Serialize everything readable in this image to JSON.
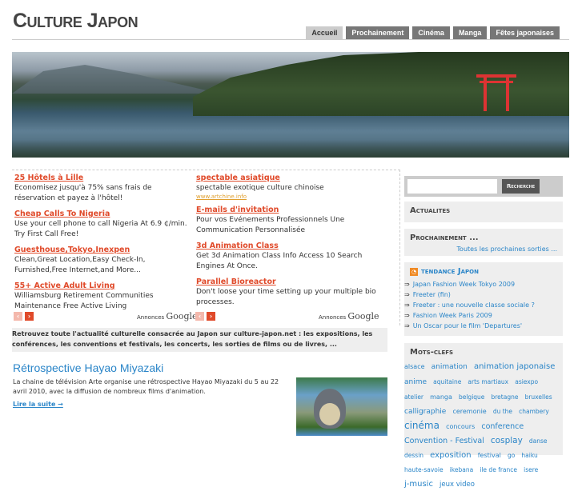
{
  "site": {
    "title": "Culture Japon"
  },
  "nav": {
    "tabs": [
      {
        "label": "Accueil",
        "active": true
      },
      {
        "label": "Prochainement"
      },
      {
        "label": "Cinéma"
      },
      {
        "label": "Manga"
      },
      {
        "label": "Fêtes japonaises"
      }
    ]
  },
  "ads": {
    "left": [
      {
        "title": "25 Hôtels à Lille",
        "text": "Economisez jusqu'à 75% sans frais de réservation et payez à l'hôtel!"
      },
      {
        "title": "Cheap Calls To Nigeria",
        "text": "Use your cell phone to call Nigeria At 6.9 ¢/min. Try First Call Free!"
      },
      {
        "title": "Guesthouse,Tokyo,Inexpen",
        "text": "Clean,Great Location,Easy Check-In, Furnished,Free Internet,and More..."
      },
      {
        "title": "55+ Active Adult Living",
        "text": "Williamsburg Retirement Communities Maintenance Free Active Living"
      }
    ],
    "right": [
      {
        "title": "spectable asiatique",
        "text": "spectable exotique culture chinoise",
        "url": "www.artchine.info"
      },
      {
        "title": "E-mails d'invitation",
        "text": "Pour vos Evénements Professionnels Une Communication Personnalisée"
      },
      {
        "title": "3d Animation Class",
        "text": "Get 3d Animation Class Info Access 10 Search Engines At Once."
      },
      {
        "title": "Parallel Bioreactor",
        "text": "Don't loose your time setting up your multiple bio processes."
      }
    ],
    "annonces": "Annonces",
    "google": "Google"
  },
  "intro": "Retrouvez toute l'actualité culturelle consacrée au Japon sur culture-japon.net : les expositions, les conférences, les conventions et festivals, les concerts, les sorties de films ou de livres, ...",
  "post": {
    "title": "Rétrospective Hayao Miyazaki",
    "text": "La chaine de télévision Arte organise une rétrospective Hayao Miyazaki du 5 au 22 avril 2010, avec la diffusion de nombreux films d'animation.",
    "read_more": "Lire la suite →"
  },
  "sidebar": {
    "search_button": "Recherche",
    "actualites": "Actualites",
    "prochainement": "Prochainement ...",
    "prochainement_link": "Toutes les prochaines sorties ...",
    "tendance": "tendance Japon",
    "tendance_items": [
      "Japan Fashion Week Tokyo 2009",
      "Freeter (fin)",
      "Freeter : une nouvelle classe sociale ?",
      "Fashion Week Paris 2009",
      "Un Oscar pour le film 'Departures'"
    ],
    "mots_clefs": "Mots-clefs",
    "tags": [
      {
        "t": "alsace",
        "s": 8
      },
      {
        "t": "animation",
        "s": 9
      },
      {
        "t": "animation japonaise",
        "s": 10
      },
      {
        "t": "anime",
        "s": 9
      },
      {
        "t": "aquitaine",
        "s": 7.5
      },
      {
        "t": "arts martiaux",
        "s": 7.5
      },
      {
        "t": "asiexpo",
        "s": 7.5
      },
      {
        "t": "atelier",
        "s": 7.5
      },
      {
        "t": "manga",
        "s": 8
      },
      {
        "t": "belgique",
        "s": 7.5
      },
      {
        "t": "bretagne",
        "s": 7.5
      },
      {
        "t": "bruxelles",
        "s": 7.5
      },
      {
        "t": "calligraphie",
        "s": 9
      },
      {
        "t": "ceremonie",
        "s": 8
      },
      {
        "t": "du the",
        "s": 7.5
      },
      {
        "t": "chambery",
        "s": 7.5
      },
      {
        "t": "cinéma",
        "s": 12
      },
      {
        "t": "concours",
        "s": 8
      },
      {
        "t": "conference",
        "s": 9.5
      },
      {
        "t": "Convention - Festival",
        "s": 9.5
      },
      {
        "t": "cosplay",
        "s": 10.5
      },
      {
        "t": "danse",
        "s": 7.5
      },
      {
        "t": "dessin",
        "s": 7.5
      },
      {
        "t": "exposition",
        "s": 10
      },
      {
        "t": "festival",
        "s": 8
      },
      {
        "t": "go",
        "s": 7.5
      },
      {
        "t": "haiku",
        "s": 7.5
      },
      {
        "t": "haute-savoie",
        "s": 7.5
      },
      {
        "t": "ikebana",
        "s": 7.5
      },
      {
        "t": "ile de france",
        "s": 7.5
      },
      {
        "t": "isere",
        "s": 7.5
      },
      {
        "t": "j-music",
        "s": 10
      },
      {
        "t": "jeux video",
        "s": 8.5
      }
    ]
  }
}
